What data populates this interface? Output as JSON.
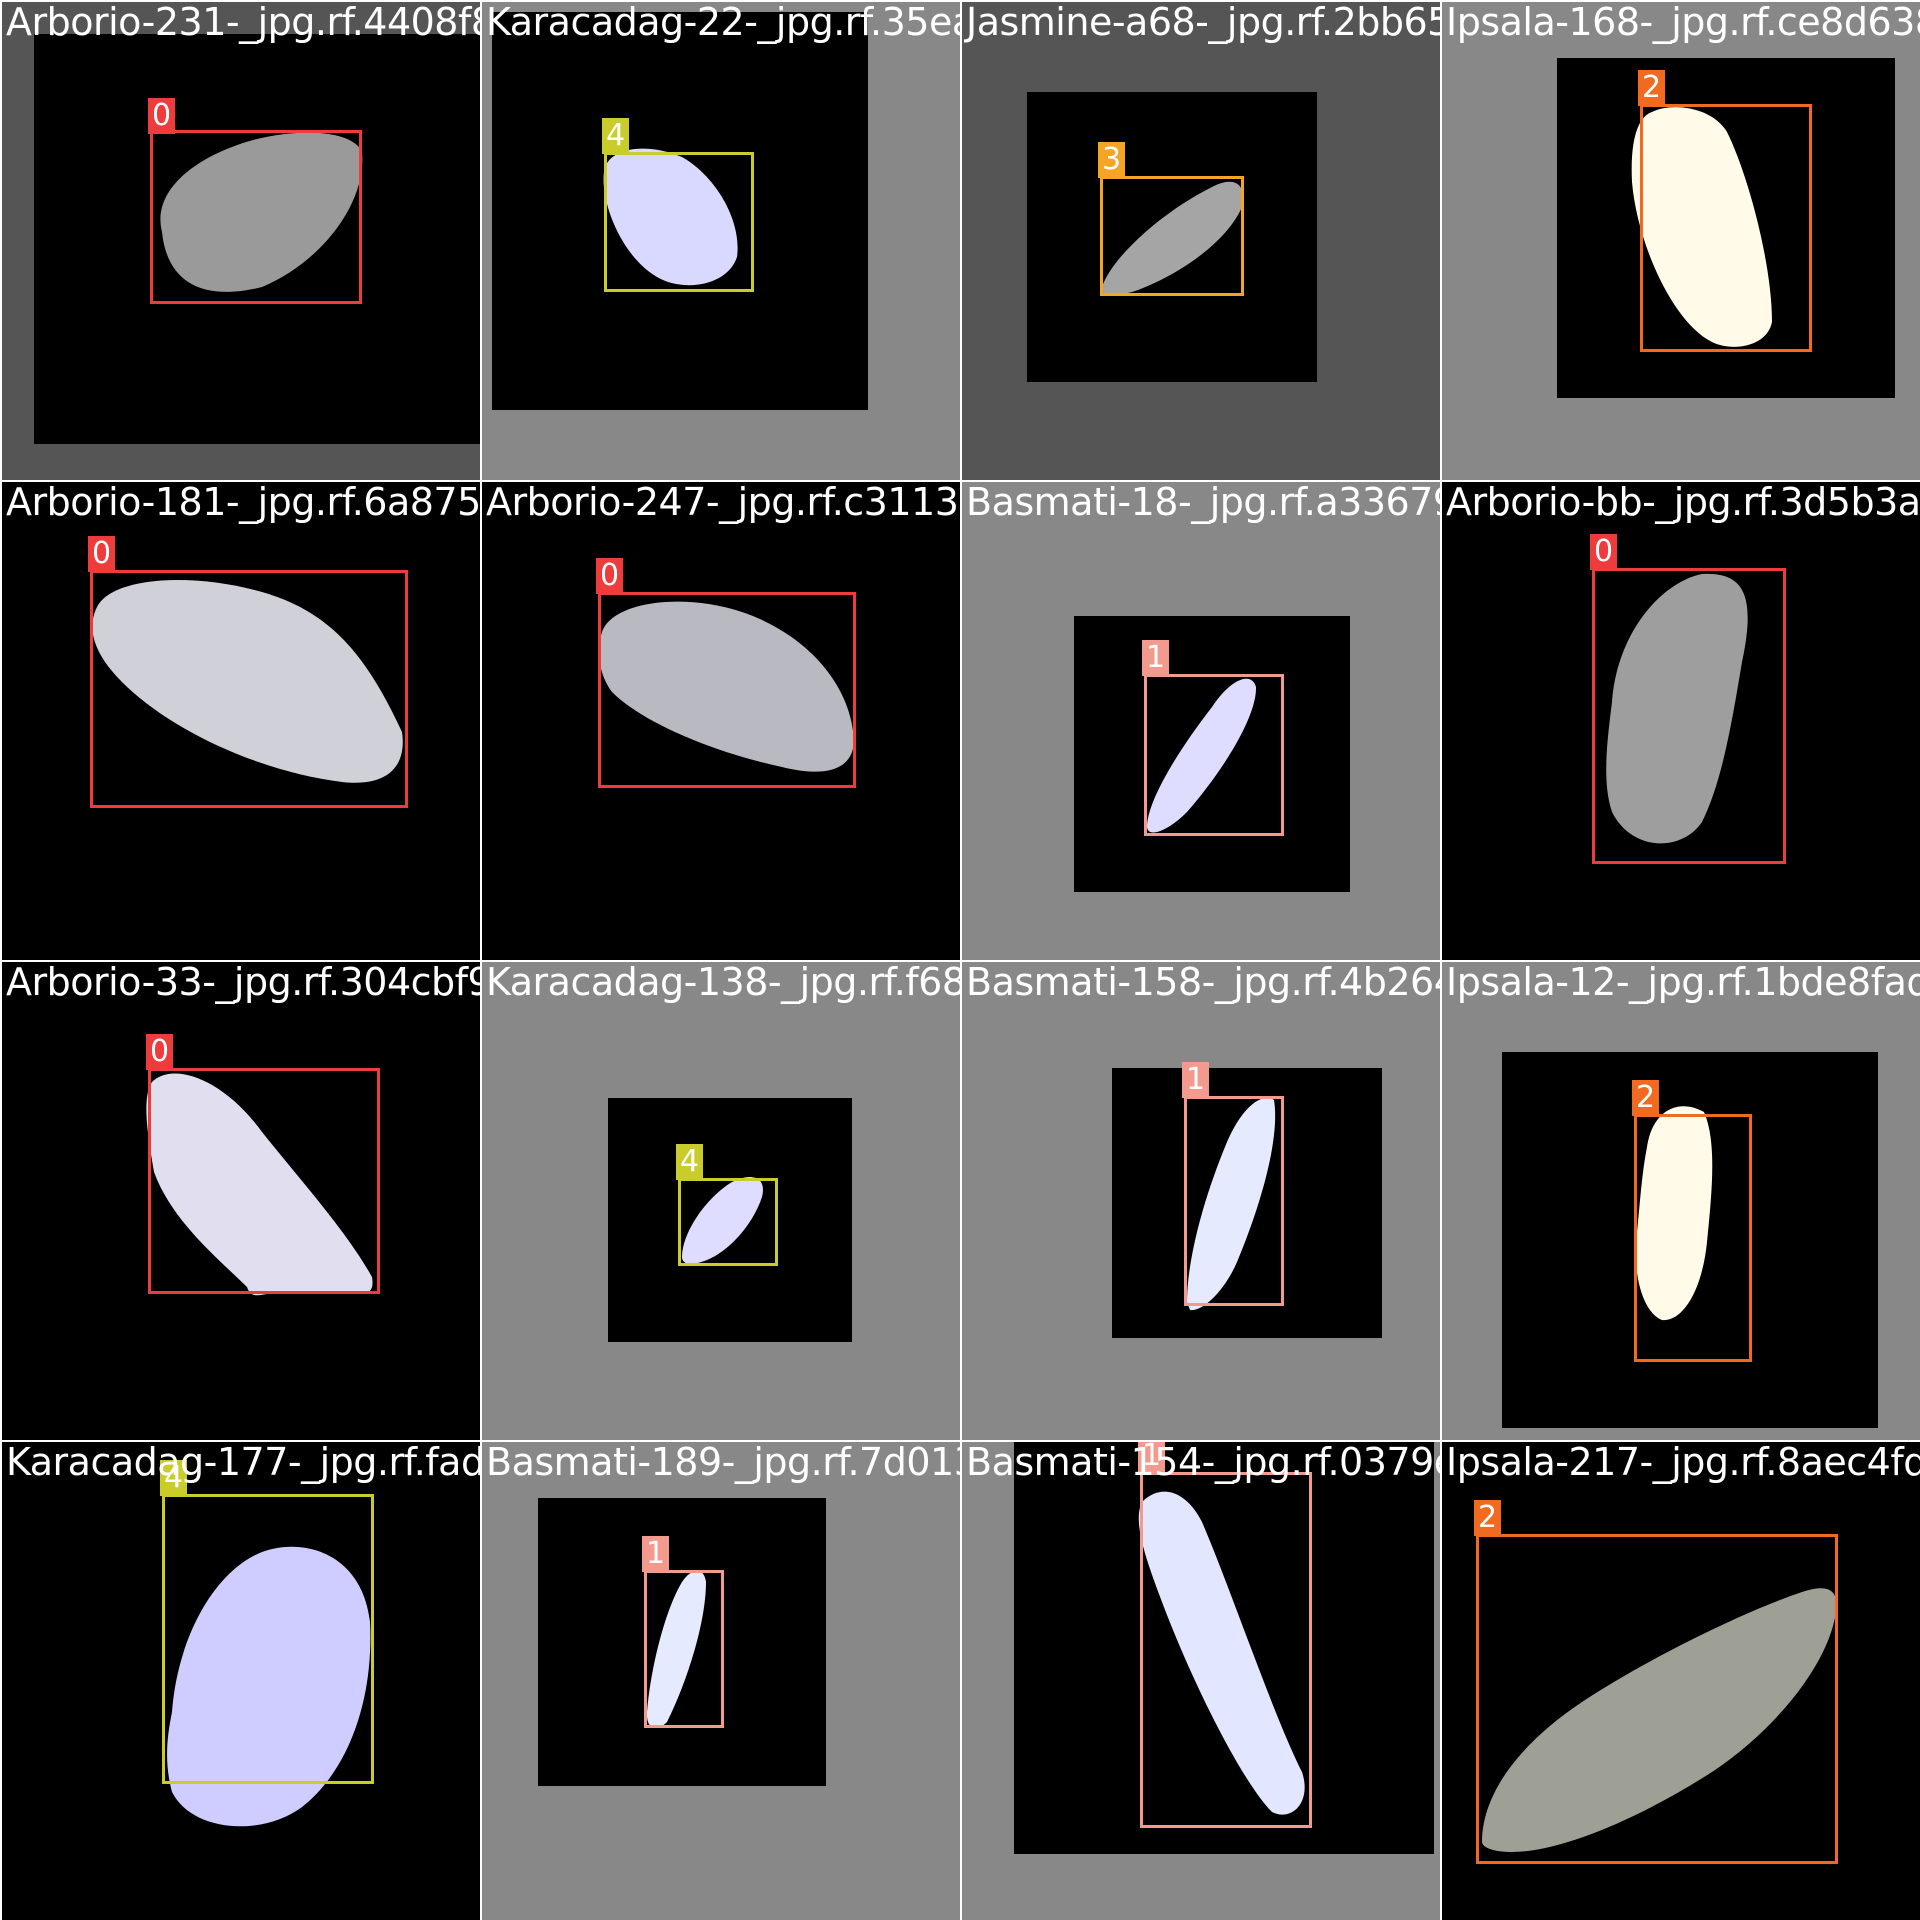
{
  "colors": {
    "class_0": "#ee3b3b",
    "class_1": "#f39a8e",
    "class_2": "#f26a1f",
    "class_3": "#f6a423",
    "class_4": "#c9cc2a"
  },
  "tiles": [
    {
      "filename": "Arborio-231-_jpg.rf.4408f8e34d4acbc3a782",
      "class_label": "0",
      "class_id": 0
    },
    {
      "filename": "Karacadag-22-_jpg.rf.35ea75b4010c4348338",
      "class_label": "4",
      "class_id": 4
    },
    {
      "filename": "Jasmine-a68-_jpg.rf.2bb658185a76873609",
      "class_label": "3",
      "class_id": 3
    },
    {
      "filename": "Ipsala-168-_jpg.rf.ce8d638e",
      "class_label": "2",
      "class_id": 2
    },
    {
      "filename": "Arborio-181-_jpg.rf.6a87533Ae3b3a21770",
      "class_label": "0",
      "class_id": 0
    },
    {
      "filename": "Arborio-247-_jpg.rf.c31138808a7c4d1b159",
      "class_label": "0",
      "class_id": 0
    },
    {
      "filename": "Basmati-18-_jpg.rf.a336798b9867c5b4a533",
      "class_label": "1",
      "class_id": 1
    },
    {
      "filename": "Arborio-bb-_jpg.rf.3d5b3af2c",
      "class_label": "0",
      "class_id": 0
    },
    {
      "filename": "Arborio-33-_jpg.rf.304cbf999K340575631d3",
      "class_label": "0",
      "class_id": 0
    },
    {
      "filename": "Karacadag-138-_jpg.rf.f68d1709d4a855b7",
      "class_label": "4",
      "class_id": 4
    },
    {
      "filename": "Basmati-158-_jpg.rf.4b26427b399012abac5",
      "class_label": "1",
      "class_id": 1
    },
    {
      "filename": "Ipsala-12-_jpg.rf.1bde8fad30",
      "class_label": "2",
      "class_id": 2
    },
    {
      "filename": "Karacadag-177-_jpg.rf.fad7e3190495189130",
      "class_label": "4",
      "class_id": 4
    },
    {
      "filename": "Basmati-189-_jpg.rf.7d0131b8928a9d5da3",
      "class_label": "1",
      "class_id": 1
    },
    {
      "filename": "Basmati-154-_jpg.rf.0379eaa4a3d0237a4132",
      "class_label": "1",
      "class_id": 1
    },
    {
      "filename": "Ipsala-217-_jpg.rf.8aec4fdd4",
      "class_label": "2",
      "class_id": 2
    }
  ]
}
